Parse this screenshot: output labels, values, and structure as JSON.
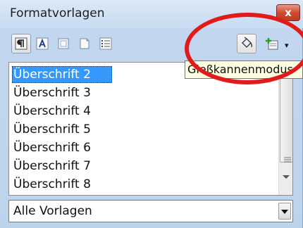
{
  "window": {
    "title": "Formatvorlagen",
    "close_glyph": "x"
  },
  "toolbar": {
    "buttons": [
      {
        "icon": "paragraph-styles-icon"
      },
      {
        "icon": "character-styles-icon"
      },
      {
        "icon": "frame-styles-icon"
      },
      {
        "icon": "page-styles-icon"
      },
      {
        "icon": "list-styles-icon"
      }
    ],
    "fill_format_icon": "paint-bucket-icon",
    "new_style_icon": "new-style-from-selection-icon",
    "dropdown_arrow": "▾"
  },
  "tooltip": {
    "text": "Gießkannenmodus"
  },
  "styles_list": {
    "items": [
      "Überschrift 2",
      "Überschrift 3",
      "Überschrift 4",
      "Überschrift 5",
      "Überschrift 6",
      "Überschrift 7",
      "Überschrift 8"
    ],
    "selected_index": 0
  },
  "filter": {
    "value": "Alle Vorlagen"
  },
  "colors": {
    "selection": "#3399ff",
    "annotation": "#e11a1a",
    "tooltip_bg": "#ffffe1"
  }
}
